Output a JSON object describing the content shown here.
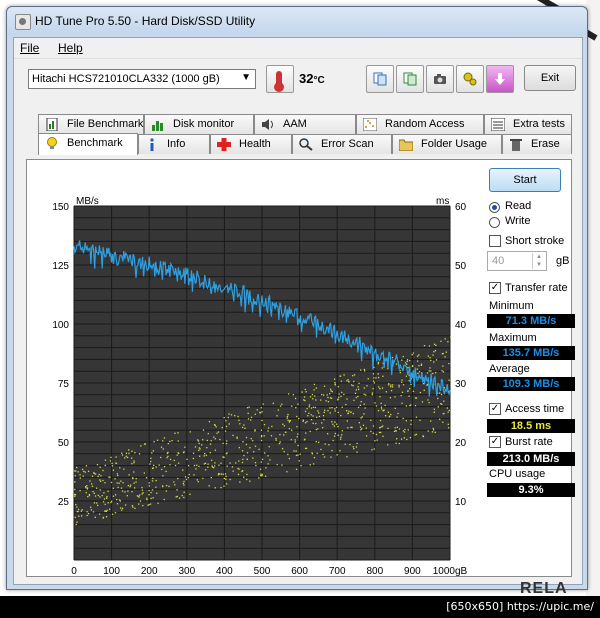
{
  "window": {
    "title": "HD Tune Pro 5.50 - Hard Disk/SSD Utility"
  },
  "menu": [
    "File",
    "Help"
  ],
  "toolbar": {
    "drive": "Hitachi HCS721010CLA332 (1000 gB)",
    "temperature": "32",
    "temperature_unit": "°C",
    "exit_label": "Exit"
  },
  "tabs_top": [
    "File Benchmark",
    "Disk monitor",
    "AAM",
    "Random Access",
    "Extra tests"
  ],
  "tabs_bottom": [
    "Benchmark",
    "Info",
    "Health",
    "Error Scan",
    "Folder Usage",
    "Erase"
  ],
  "active_tab": "Benchmark",
  "right_panel": {
    "start_label": "Start",
    "read_label": "Read",
    "write_label": "Write",
    "read_selected": true,
    "short_stroke_label": "Short stroke",
    "short_stroke_checked": false,
    "short_stroke_value": "40",
    "short_stroke_unit": "gB",
    "transfer_rate_label": "Transfer rate",
    "transfer_rate_checked": true,
    "minimum_label": "Minimum",
    "minimum_value": "71.3 MB/s",
    "maximum_label": "Maximum",
    "maximum_value": "135.7 MB/s",
    "average_label": "Average",
    "average_value": "109.3 MB/s",
    "access_time_label": "Access time",
    "access_time_checked": true,
    "access_time_value": "18.5 ms",
    "burst_rate_label": "Burst rate",
    "burst_rate_checked": true,
    "burst_rate_value": "213.0 MB/s",
    "cpu_usage_label": "CPU usage",
    "cpu_usage_value": "9.3%"
  },
  "colors": {
    "plot_background": "#363636",
    "grid": "#1a1a1a",
    "transfer_line": "#2e9fe0",
    "access_dots": "#d8d84a",
    "value_box": "#000000"
  },
  "chart_data": {
    "type": "line",
    "y_left_label": "MB/s",
    "y_right_label": "ms",
    "x_unit_label": "gB",
    "x_ticks": [
      "0",
      "100",
      "200",
      "300",
      "400",
      "500",
      "600",
      "700",
      "800",
      "900",
      "1000gB"
    ],
    "y_left_ticks": [
      "150",
      "125",
      "100",
      "75",
      "50",
      "25"
    ],
    "y_right_ticks": [
      "60",
      "50",
      "40",
      "30",
      "20",
      "10"
    ],
    "xlim": [
      0,
      1000
    ],
    "ylim_left": [
      0,
      150
    ],
    "ylim_right": [
      0,
      60
    ],
    "grid": true,
    "series": [
      {
        "axis": "left",
        "x": [
          0,
          20,
          40,
          60,
          80,
          100,
          120,
          140,
          160,
          180,
          200,
          220,
          240,
          260,
          280,
          300,
          320,
          340,
          360,
          380,
          400,
          420,
          440,
          460,
          480,
          500,
          520,
          540,
          560,
          580,
          600,
          620,
          640,
          660,
          680,
          700,
          720,
          740,
          760,
          780,
          800,
          820,
          840,
          860,
          880,
          900,
          920,
          940,
          960,
          980,
          1000
        ],
        "y": [
          133,
          134,
          132,
          131,
          130,
          129,
          128,
          128,
          127,
          126,
          126,
          125,
          124,
          123,
          122,
          121,
          120,
          119,
          118,
          117,
          116,
          115,
          114,
          113,
          111,
          110,
          109,
          107,
          106,
          105,
          103,
          102,
          101,
          99,
          98,
          96,
          95,
          93,
          92,
          90,
          88,
          87,
          85,
          84,
          82,
          80,
          78,
          77,
          75,
          74,
          72
        ]
      },
      {
        "axis": "right",
        "kind": "scatter",
        "x_range": [
          0,
          1000
        ],
        "y_start_range": [
          6,
          16
        ],
        "y_end_range": [
          22,
          38
        ]
      }
    ]
  }
}
